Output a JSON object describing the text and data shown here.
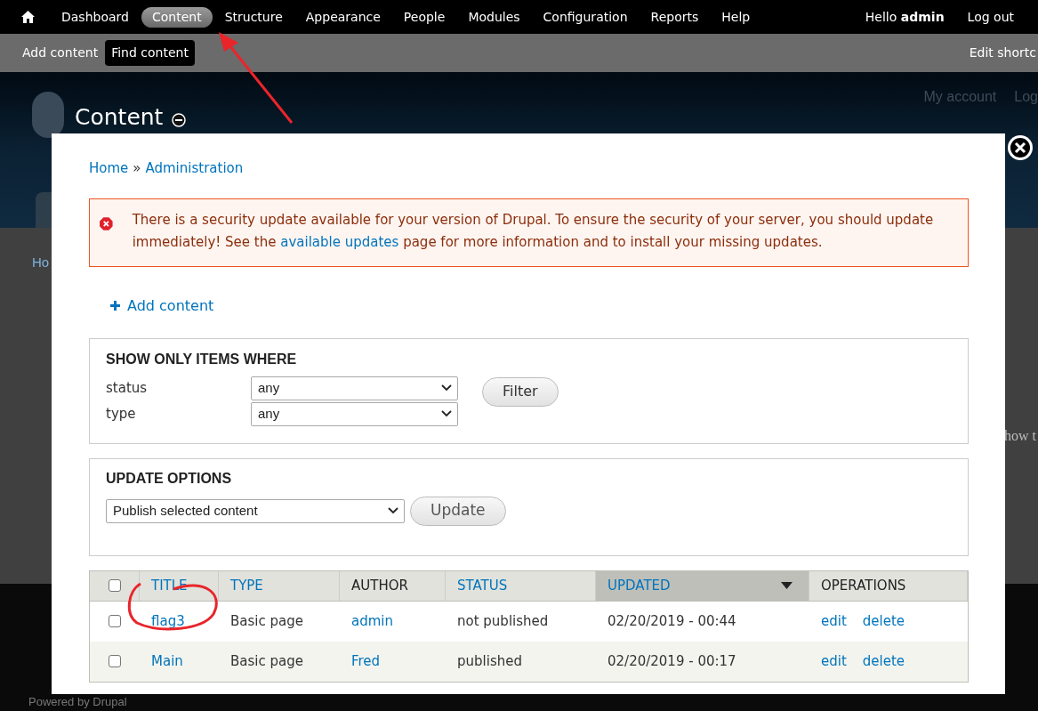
{
  "toolbar": {
    "items": [
      {
        "label": "Dashboard",
        "selected": false
      },
      {
        "label": "Content",
        "selected": true
      },
      {
        "label": "Structure",
        "selected": false
      },
      {
        "label": "Appearance",
        "selected": false
      },
      {
        "label": "People",
        "selected": false
      },
      {
        "label": "Modules",
        "selected": false
      },
      {
        "label": "Configuration",
        "selected": false
      },
      {
        "label": "Reports",
        "selected": false
      },
      {
        "label": "Help",
        "selected": false
      }
    ],
    "greeting": "Hello",
    "user": "admin",
    "logout": "Log out"
  },
  "shortcuts": {
    "items": [
      {
        "label": "Add content",
        "selected": false
      },
      {
        "label": "Find content",
        "selected": true
      }
    ],
    "edit": "Edit shortc"
  },
  "site_header": {
    "page_title": "Content",
    "links": [
      "My account",
      "Log"
    ]
  },
  "background": {
    "breadcrumb": "Ho",
    "text": "how t",
    "footer": "Powered by Drupal"
  },
  "modal": {
    "breadcrumb": [
      "Home",
      "Administration"
    ],
    "separator": "»",
    "message": {
      "before": "There is a security update available for your version of Drupal. To ensure the security of your server, you should update immediately! See the ",
      "link": "available updates",
      "after": " page for more information and to install your missing updates."
    },
    "action": "Add content",
    "filter": {
      "legend": "SHOW ONLY ITEMS WHERE",
      "fields": [
        {
          "label": "status",
          "value": "any"
        },
        {
          "label": "type",
          "value": "any"
        }
      ],
      "button": "Filter"
    },
    "update": {
      "legend": "UPDATE OPTIONS",
      "value": "Publish selected content",
      "button": "Update"
    },
    "table": {
      "select_all": {
        "checked": false
      },
      "columns": [
        {
          "label": "TITLE",
          "link": true,
          "selected": false
        },
        {
          "label": "TYPE",
          "link": true,
          "selected": false
        },
        {
          "label": "AUTHOR",
          "link": false,
          "selected": false
        },
        {
          "label": "STATUS",
          "link": true,
          "selected": false
        },
        {
          "label": "UPDATED",
          "link": true,
          "selected": true
        },
        {
          "label": "OPERATIONS",
          "link": false,
          "selected": false
        }
      ],
      "rows": [
        {
          "checked": false,
          "title": "flag3",
          "type": "Basic page",
          "author": "admin",
          "status": "not published",
          "updated": "02/20/2019 - 00:44",
          "operations": [
            "edit",
            "delete"
          ]
        },
        {
          "checked": false,
          "title": "Main",
          "type": "Basic page",
          "author": "Fred",
          "status": "published",
          "updated": "02/20/2019 - 00:17",
          "operations": [
            "edit",
            "delete"
          ]
        }
      ]
    }
  }
}
